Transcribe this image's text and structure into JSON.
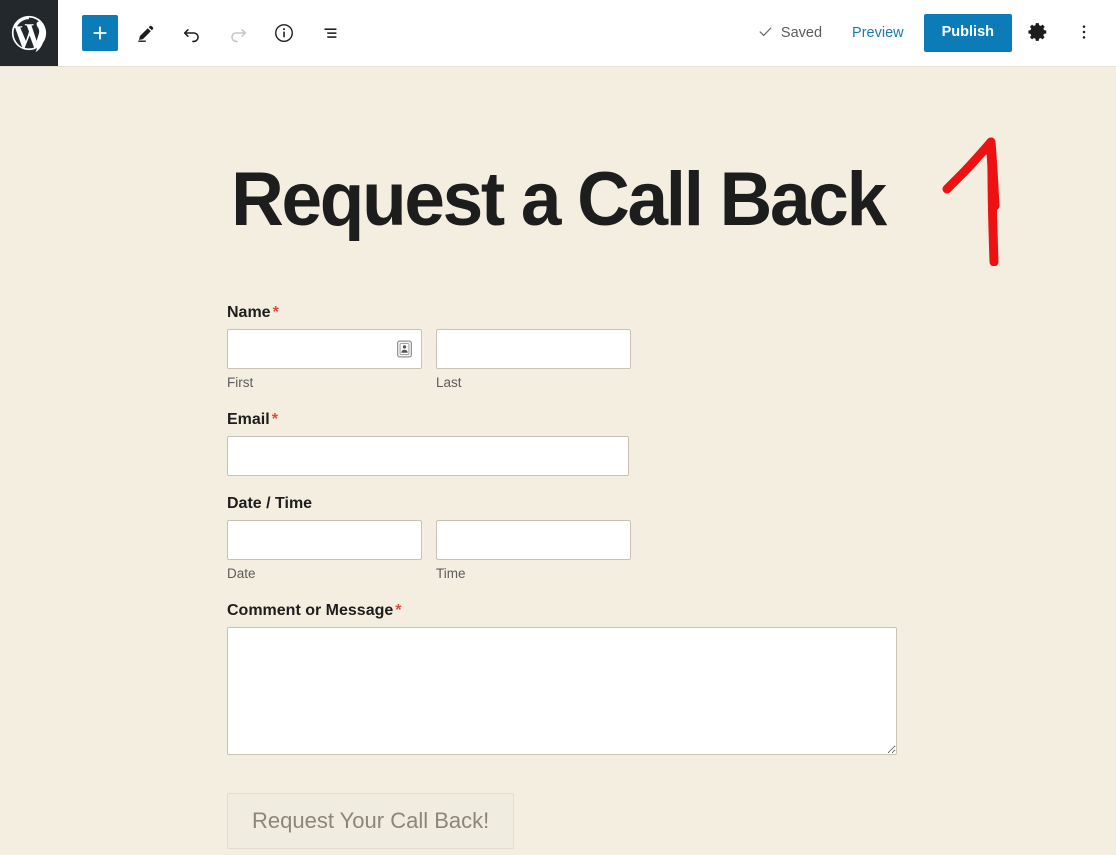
{
  "header": {
    "logo_label": "WordPress",
    "left_tools": [
      {
        "name": "add-block-button",
        "label": "Add block",
        "icon": "plus-icon"
      },
      {
        "name": "edit-tool-button",
        "label": "Edit",
        "icon": "pencil-icon"
      },
      {
        "name": "undo-button",
        "label": "Undo",
        "icon": "undo-arrow-icon"
      },
      {
        "name": "redo-button",
        "label": "Redo",
        "icon": "redo-arrow-icon"
      },
      {
        "name": "details-button",
        "label": "Details",
        "icon": "info-circle-icon"
      },
      {
        "name": "list-view-button",
        "label": "List view",
        "icon": "list-view-icon"
      }
    ],
    "saved_label": "Saved",
    "preview_label": "Preview",
    "publish_label": "Publish",
    "settings_label": "Settings",
    "options_label": "Options",
    "accent_color": "#0b7cb8",
    "link_color": "#1979b5",
    "logo_bg": "#23282d"
  },
  "page": {
    "title": "Request a Call Back",
    "background_color": "#f4eee1",
    "title_color": "#1d1d1d"
  },
  "form": {
    "required_marker": "*",
    "required_color": "#e8493b",
    "fields": [
      {
        "name": "name",
        "label": "Name",
        "required": true,
        "subfields": [
          {
            "name": "first",
            "sub_label": "First",
            "value": "",
            "placeholder": "",
            "has_autofill_icon": true
          },
          {
            "name": "last",
            "sub_label": "Last",
            "value": "",
            "placeholder": "",
            "has_autofill_icon": false
          }
        ]
      },
      {
        "name": "email",
        "label": "Email",
        "required": true,
        "value": "",
        "placeholder": ""
      },
      {
        "name": "datetime",
        "label": "Date / Time",
        "required": false,
        "subfields": [
          {
            "name": "date",
            "sub_label": "Date",
            "value": "",
            "placeholder": "",
            "has_autofill_icon": false
          },
          {
            "name": "time",
            "sub_label": "Time",
            "value": "",
            "placeholder": "",
            "has_autofill_icon": false
          }
        ]
      },
      {
        "name": "message",
        "label": "Comment or Message",
        "required": true,
        "value": "",
        "placeholder": ""
      }
    ],
    "submit_label": "Request Your Call Back!"
  },
  "annotation": {
    "name": "red-arrow-pointing-to-publish",
    "color": "#ee1111",
    "points_to": "Publish"
  }
}
